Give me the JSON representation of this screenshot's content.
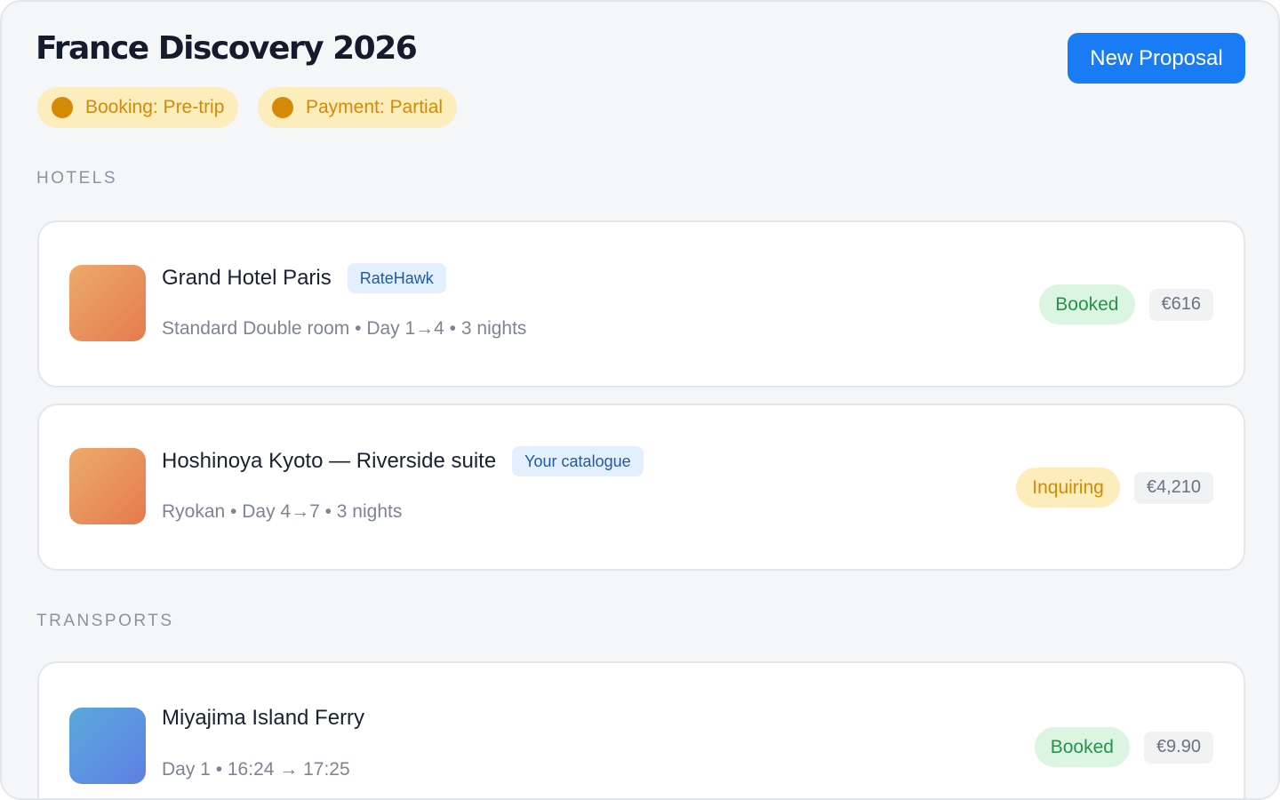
{
  "header": {
    "title": "France Discovery 2026",
    "new_proposal_label": "New Proposal",
    "status_pills": [
      {
        "label": "Booking: Pre-trip"
      },
      {
        "label": "Payment: Partial"
      }
    ]
  },
  "sections": {
    "hotels_label": "HOTELS",
    "transports_label": "TRANSPORTS"
  },
  "hotels": [
    {
      "name": "Grand Hotel Paris",
      "source": "RateHawk",
      "details": "Standard Double room • Day 1→4 • 3 nights",
      "status": "Booked",
      "price": "€616",
      "thumb_icon": "hotel-thumbnail"
    },
    {
      "name": "Hoshinoya Kyoto — Riverside suite",
      "source": "Your catalogue",
      "details": "Ryokan • Day 4→7 • 3 nights",
      "status": "Inquiring",
      "price": "€4,210",
      "thumb_icon": "hotel-thumbnail"
    }
  ],
  "transports": [
    {
      "name": "Miyajima Island Ferry",
      "details": "Day 1 • 16:24 → 17:25",
      "status": "Booked",
      "price": "€9.90",
      "thumb_icon": "transport-thumbnail"
    }
  ],
  "colors": {
    "accent": "#1a7cf5",
    "pending": "#d58a05",
    "booked": "#27924a"
  }
}
